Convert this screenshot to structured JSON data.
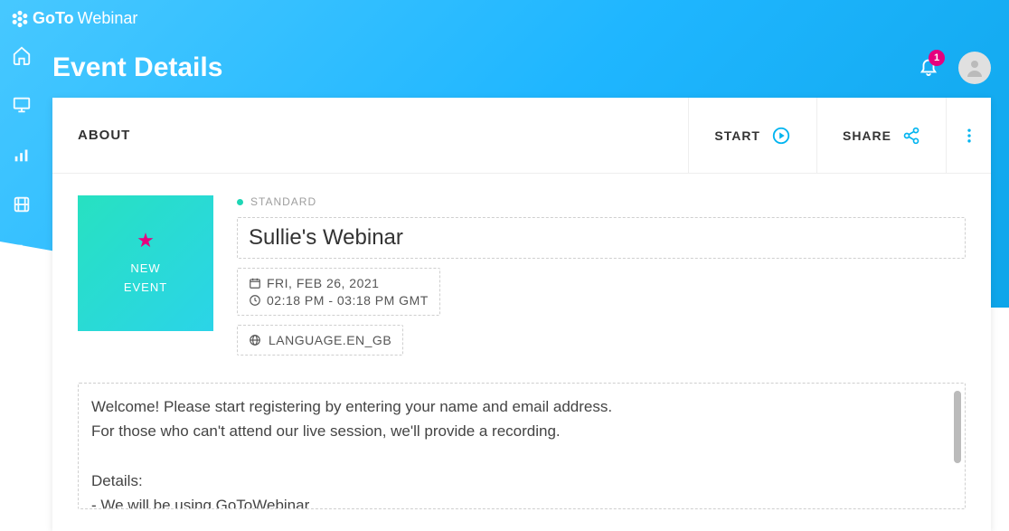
{
  "brand": {
    "name_strong": "GoTo",
    "name_light": "Webinar"
  },
  "page": {
    "title": "Event Details"
  },
  "notifications": {
    "count": "1"
  },
  "tabs": {
    "about": "ABOUT"
  },
  "actions": {
    "start": "START",
    "share": "SHARE"
  },
  "thumbnail": {
    "line1": "NEW",
    "line2": "EVENT"
  },
  "event": {
    "status": "STANDARD",
    "title": "Sullie's Webinar",
    "date": "FRI, FEB 26, 2021",
    "time": "02:18 PM - 03:18 PM GMT",
    "language": "LANGUAGE.EN_GB",
    "description": "Welcome! Please start registering by entering your name and email address.\nFor those who can't attend our live session, we'll provide a recording.\n\nDetails:\n- We will be using GoToWebinar."
  }
}
